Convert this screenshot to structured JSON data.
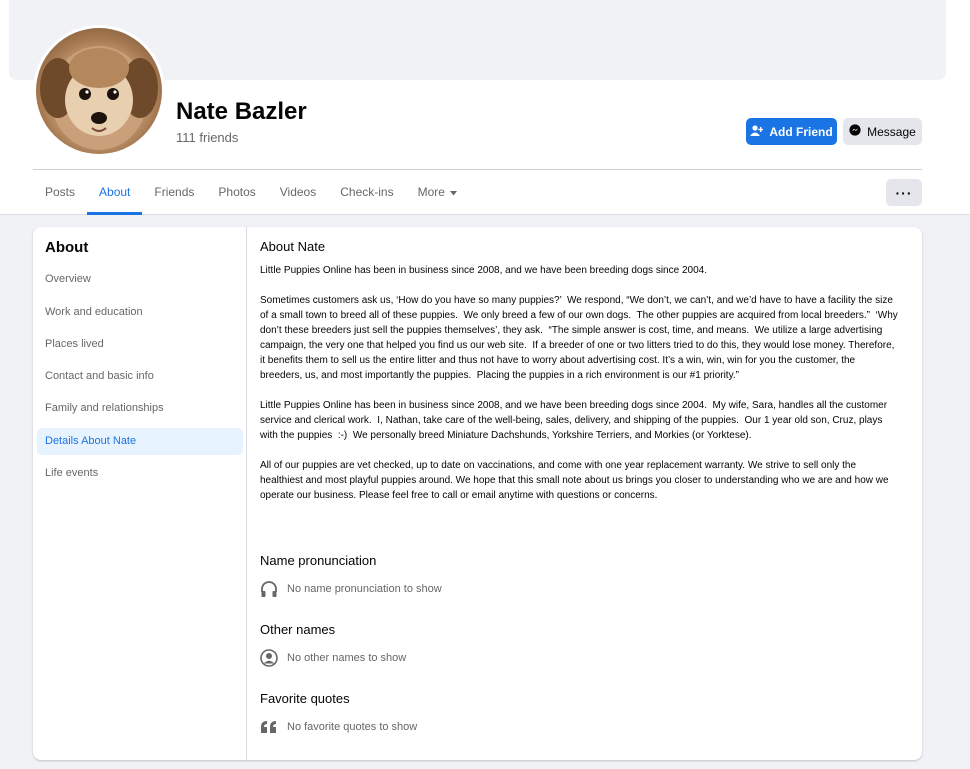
{
  "profile": {
    "name": "Nate Bazler",
    "friends": "111 friends"
  },
  "actions": {
    "add_friend": "Add Friend",
    "message": "Message",
    "more_menu": "···"
  },
  "tabs": [
    {
      "label": "Posts",
      "active": false
    },
    {
      "label": "About",
      "active": true
    },
    {
      "label": "Friends",
      "active": false
    },
    {
      "label": "Photos",
      "active": false
    },
    {
      "label": "Videos",
      "active": false
    },
    {
      "label": "Check-ins",
      "active": false
    },
    {
      "label": "More",
      "active": false
    }
  ],
  "sidebar": {
    "title": "About",
    "items": [
      {
        "label": "Overview",
        "active": false
      },
      {
        "label": "Work and education",
        "active": false
      },
      {
        "label": "Places lived",
        "active": false
      },
      {
        "label": "Contact and basic info",
        "active": false
      },
      {
        "label": "Family and relationships",
        "active": false
      },
      {
        "label": "Details About Nate",
        "active": true
      },
      {
        "label": "Life events",
        "active": false
      }
    ]
  },
  "about": {
    "title": "About Nate",
    "paragraphs": [
      "Little Puppies Online has been in business since 2008, and we have been breeding dogs since 2004.",
      "Sometimes customers ask us, ‘How do you have so many puppies?’  We respond, “We don’t, we can’t, and we’d have to have a facility the size of a small town to breed all of these puppies.  We only breed a few of our own dogs.  The other puppies are acquired from local breeders.”  ‘Why don’t these breeders just sell the puppies themselves’, they ask.  “The simple answer is cost, time, and means.  We utilize a large advertising campaign, the very one that helped you find us our web site.  If a breeder of one or two litters tried to do this, they would lose money. Therefore, it benefits them to sell us the entire litter and thus not have to worry about advertising cost. It’s a win, win, win for you the customer, the breeders, us, and most importantly the puppies.  Placing the puppies in a rich environment is our #1 priority.”",
      "Little Puppies Online has been in business since 2008, and we have been breeding dogs since 2004.  My wife, Sara, handles all the customer service and clerical work.  I, Nathan, take care of the well-being, sales, delivery, and shipping of the puppies.  Our 1 year old son, Cruz, plays with the puppies  :-)  We personally breed Miniature Dachshunds, Yorkshire Terriers, and Morkies (or Yorktese).",
      "All of our puppies are vet checked, up to date on vaccinations, and come with one year replacement warranty. We strive to sell only the healthiest and most playful puppies around. We hope that this small note about us brings you closer to understanding who we are and how we operate our business. Please feel free to call or email anytime with questions or concerns."
    ]
  },
  "sections": {
    "pronunciation": {
      "title": "Name pronunciation",
      "empty": "No name pronunciation to show",
      "icon": "headphones-icon"
    },
    "other_names": {
      "title": "Other names",
      "empty": "No other names to show",
      "icon": "person-circle-icon"
    },
    "quotes": {
      "title": "Favorite quotes",
      "empty": "No favorite quotes to show",
      "icon": "quote-icon"
    }
  },
  "colors": {
    "accent": "#1b74e4",
    "secondary_text": "#65676b",
    "background": "#f0f2f5",
    "active_bg": "#e7f3ff"
  }
}
